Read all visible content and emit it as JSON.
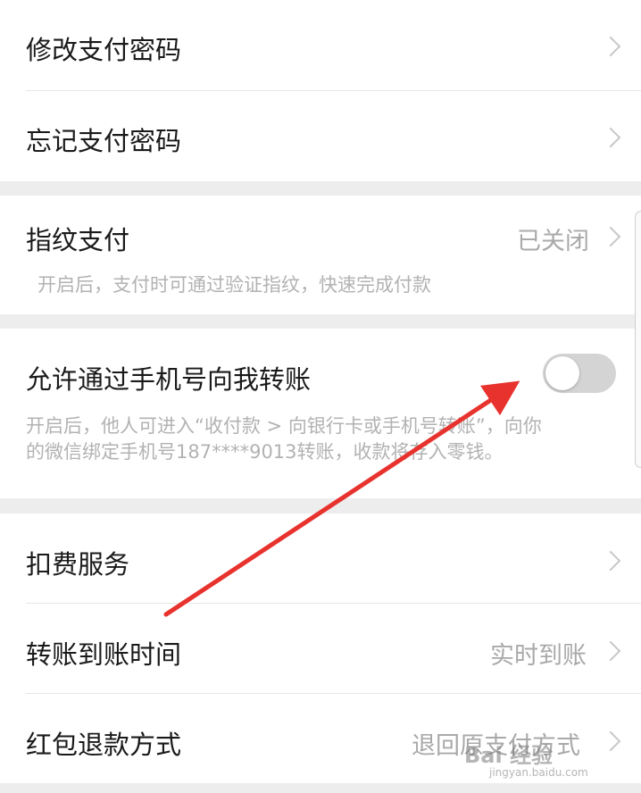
{
  "section1": {
    "items": [
      {
        "label": "修改支付密码"
      },
      {
        "label": "忘记支付密码"
      }
    ]
  },
  "fingerprint": {
    "label": "指纹支付",
    "value": "已关闭",
    "description": "开启后，支付时可通过验证指纹，快速完成付款"
  },
  "phone_transfer": {
    "label": "允许通过手机号向我转账",
    "toggle_on": false,
    "description_line1": "开启后，他人可进入“收付款 > 向银行卡或手机号转账”，向你",
    "description_line2": "的微信绑定手机号187****9013转账，收款将存入零钱。"
  },
  "section4": {
    "items": [
      {
        "label": "扣费服务",
        "value": ""
      },
      {
        "label": "转账到账时间",
        "value": "实时到账"
      },
      {
        "label": "红包退款方式",
        "value": "退回原支付方式"
      }
    ]
  },
  "annotation": {
    "arrow_color": "#e8322d"
  },
  "watermark": {
    "main": "Bai 经验",
    "sub": "jingyan.baidu.com"
  }
}
